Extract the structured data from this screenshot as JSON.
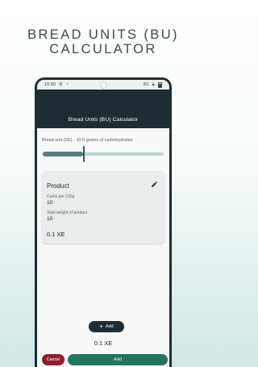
{
  "promo": {
    "title_line1": "BREAD UNITS (BU)",
    "title_line2": "CALCULATOR"
  },
  "status_bar": {
    "time": "10:30",
    "network": "3G"
  },
  "appbar": {
    "title": "Bread Units (BU) Calculator"
  },
  "settings": {
    "unit_caption": "Bread unit (XE) - 10.0 grams of carbohydrates",
    "slider_fraction": 0.33
  },
  "product_card": {
    "title": "Product",
    "carbs_label": "Carbs per 100g",
    "carbs_value": "10",
    "weight_label": "Total weight of product",
    "weight_value": "10",
    "result": "0.1 XE"
  },
  "actions": {
    "fab_label": "Add",
    "total_result": "0.1 XE",
    "cancel_label": "Cancel",
    "add_label": "Add"
  },
  "colors": {
    "appbar": "#1e2d33",
    "cancel": "#8e1f2f",
    "add": "#23755f",
    "slider": "#4f7e83"
  }
}
